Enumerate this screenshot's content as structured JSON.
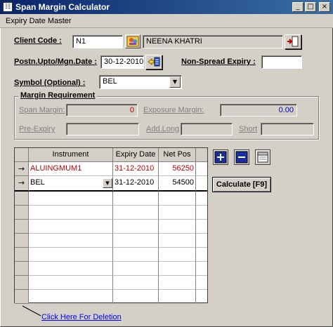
{
  "window": {
    "title": "Span Margin Calculator",
    "minimize": "_",
    "maximize": "□",
    "close": "×"
  },
  "menu": {
    "item1": "Expiry Date Master"
  },
  "client": {
    "label": "Client Code :",
    "code": "N1",
    "name": "NEENA KHATRI"
  },
  "postn": {
    "label": "Postn.Upto/Mgn.Date :",
    "date": "30-12-2010",
    "non_spread_label": "Non-Spread Expiry :",
    "non_spread_value": ""
  },
  "symbol": {
    "label": "Symbol (Optional) :",
    "value": "BEL"
  },
  "margin": {
    "title": "Margin Requirement",
    "span_label": "Span Margin:",
    "span_value": "0",
    "exposure_label": "Exposure Margin:",
    "exposure_value": "0.00",
    "pre_expiry_label": "Pre-Expiry",
    "pre_expiry_value": "",
    "add_long_label": "Add.Long",
    "add_long_value": "",
    "short_label": "Short",
    "short_value": ""
  },
  "grid": {
    "headers": {
      "instrument": "Instrument",
      "expiry": "Expiry Date",
      "netpos": "Net Pos"
    },
    "rows": [
      {
        "indicator": "→",
        "instrument": "ALUINGMUM1",
        "expiry": "31-12-2010",
        "netpos": "56250"
      },
      {
        "indicator": "→",
        "instrument": "BEL",
        "expiry": "31-12-2010",
        "netpos": "54500"
      }
    ]
  },
  "actions": {
    "calculate": "Calculate [F9]",
    "deletion_link": "Click Here For Deletion"
  },
  "colors": {
    "titlebar": "#0a246a",
    "red_text": "#c00000",
    "blue_text": "#0000c0",
    "link": "#0000ff"
  }
}
